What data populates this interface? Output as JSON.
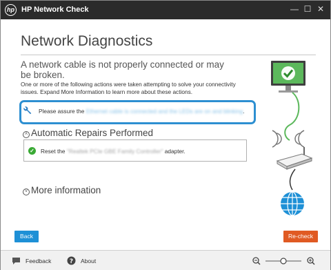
{
  "window": {
    "logo_text": "hp",
    "title": "HP Network Check",
    "controls": {
      "minimize": "—",
      "maximize": "☐",
      "close": "✕"
    }
  },
  "main": {
    "heading": "Network Diagnostics",
    "message": "A network cable is not properly connected or may be broken.",
    "details": "One or more of the following actions were taken attempting to solve your connectivity issues. Expand More Information to learn more about these actions.",
    "action_prefix": "Please assure the ",
    "action_blurred": "Ethernet cable is connected and the LEDs are on and blinking",
    "action_suffix": ".",
    "repairs_title": "Automatic Repairs Performed",
    "repair_prefix": "Reset the ",
    "repair_blurred": "\"Realtek PCIe GBE Family Controller\"",
    "repair_suffix": " adapter.",
    "more_info": "More information"
  },
  "buttons": {
    "back": "Back",
    "recheck": "Re-check"
  },
  "footer": {
    "feedback": "Feedback",
    "about": "About"
  },
  "zoom": {
    "level_fraction": 0.5
  },
  "colors": {
    "accent_blue": "#1e90d6",
    "recheck_orange": "#e05a23",
    "success_green": "#3aaa35",
    "titlebar": "#2b2b2b"
  }
}
